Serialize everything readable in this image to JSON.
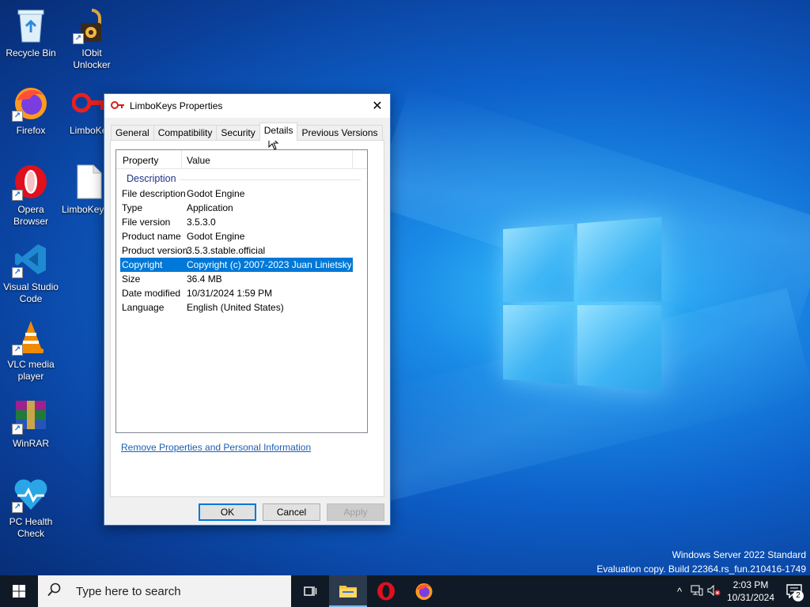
{
  "desktop": {
    "icons": [
      {
        "label": "Recycle Bin"
      },
      {
        "label": "IObit Unlocker"
      },
      {
        "label": "Firefox"
      },
      {
        "label": "LimboKeys"
      },
      {
        "label": "Opera Browser"
      },
      {
        "label": "LimboKeys"
      },
      {
        "label": "Visual Studio Code"
      },
      {
        "label": "VLC media player"
      },
      {
        "label": "WinRAR"
      },
      {
        "label": "PC Health Check"
      }
    ],
    "watermark": {
      "line1": "Windows Server 2022 Standard",
      "line2": "Evaluation copy. Build 22364.rs_fun.210416-1749"
    }
  },
  "dialog": {
    "title": "LimboKeys Properties",
    "tabs": [
      "General",
      "Compatibility",
      "Security",
      "Details",
      "Previous Versions"
    ],
    "active_tab": "Details",
    "columns": {
      "property": "Property",
      "value": "Value"
    },
    "group": "Description",
    "rows": [
      {
        "property": "File description",
        "value": "Godot Engine"
      },
      {
        "property": "Type",
        "value": "Application"
      },
      {
        "property": "File version",
        "value": "3.5.3.0"
      },
      {
        "property": "Product name",
        "value": "Godot Engine"
      },
      {
        "property": "Product version",
        "value": "3.5.3.stable.official"
      },
      {
        "property": "Copyright",
        "value": "Copyright (c) 2007-2023 Juan Linietsky, ..."
      },
      {
        "property": "Size",
        "value": "36.4 MB"
      },
      {
        "property": "Date modified",
        "value": "10/31/2024 1:59 PM"
      },
      {
        "property": "Language",
        "value": "English (United States)"
      }
    ],
    "selected_row": "Copyright",
    "remove_link": "Remove Properties and Personal Information",
    "buttons": {
      "ok": "OK",
      "cancel": "Cancel",
      "apply": "Apply"
    }
  },
  "taskbar": {
    "search_placeholder": "Type here to search",
    "clock_time": "2:03 PM",
    "clock_date": "10/31/2024",
    "notification_count": "2"
  },
  "colors": {
    "accent": "#0078d7",
    "taskbar": "#101a26",
    "link": "#1a5fb4"
  }
}
